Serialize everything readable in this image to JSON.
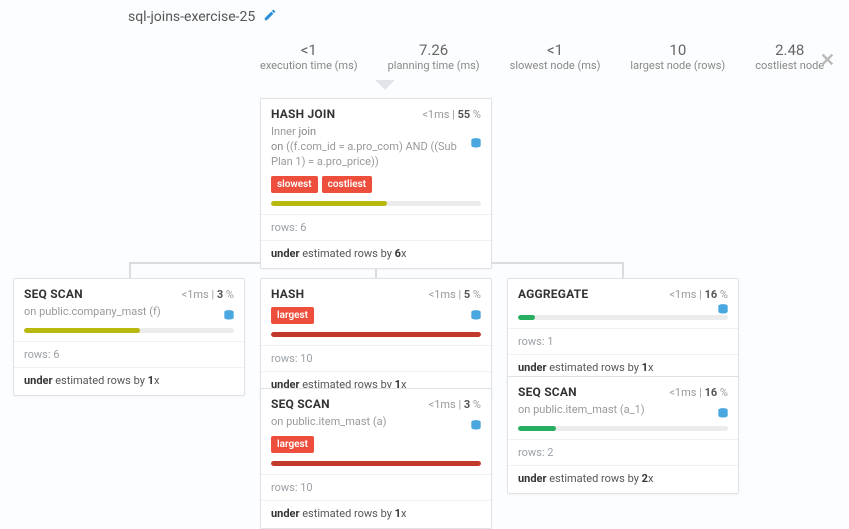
{
  "title": "sql-joins-exercise-25",
  "stats": {
    "execution_time": {
      "value": "<1",
      "label": "execution time (ms)"
    },
    "planning_time": {
      "value": "7.26",
      "label": "planning time (ms)"
    },
    "slowest_node": {
      "value": "<1",
      "label": "slowest node (ms)"
    },
    "largest_node": {
      "value": "10",
      "label": "largest node (rows)"
    },
    "costliest_node": {
      "value": "2.48",
      "label": "costliest node"
    }
  },
  "keywords": {
    "join": "join",
    "on": "on",
    "under": "under"
  },
  "nodes": {
    "hashjoin": {
      "title": "HASH JOIN",
      "time": "<1ms",
      "pct": "55",
      "sub_prefix": "Inner ",
      "cond": " ((f.com_id = a.pro_com) AND ((Sub Plan 1) = a.pro_price))",
      "badges": [
        "slowest",
        "costliest"
      ],
      "bar_pct": 55,
      "bar_color": "bar-olive",
      "rows": "rows: 6",
      "est_val": "6",
      "est_suffix": "x",
      "est_text": " estimated rows by "
    },
    "seqscan1": {
      "title": "SEQ SCAN",
      "time": "<1ms",
      "pct": "3",
      "sub": "on public.company_mast (f)",
      "bar_pct": 55,
      "bar_color": "bar-olive",
      "rows": "rows: 6",
      "est_val": "1",
      "est_suffix": "x",
      "est_text": " estimated rows by "
    },
    "hash": {
      "title": "HASH",
      "time": "<1ms",
      "pct": "5",
      "badges": [
        "largest"
      ],
      "bar_pct": 100,
      "bar_color": "bar-red",
      "rows": "rows: 10",
      "est_val": "1",
      "est_suffix": "x",
      "est_text": " estimated rows by "
    },
    "aggregate": {
      "title": "AGGREGATE",
      "time": "<1ms",
      "pct": "16",
      "bar_pct": 8,
      "bar_color": "bar-green",
      "rows": "rows: 1",
      "est_val": "1",
      "est_suffix": "x",
      "est_text": " estimated rows by "
    },
    "seqscan2": {
      "title": "SEQ SCAN",
      "time": "<1ms",
      "pct": "3",
      "sub": "on public.item_mast (a)",
      "badges": [
        "largest"
      ],
      "bar_pct": 100,
      "bar_color": "bar-red",
      "rows": "rows: 10",
      "est_val": "1",
      "est_suffix": "x",
      "est_text": " estimated rows by "
    },
    "seqscan3": {
      "title": "SEQ SCAN",
      "time": "<1ms",
      "pct": "16",
      "sub": "on public.item_mast (a_1)",
      "bar_pct": 18,
      "bar_color": "bar-green",
      "rows": "rows: 2",
      "est_val": "2",
      "est_suffix": "x",
      "est_text": " estimated rows by "
    }
  }
}
